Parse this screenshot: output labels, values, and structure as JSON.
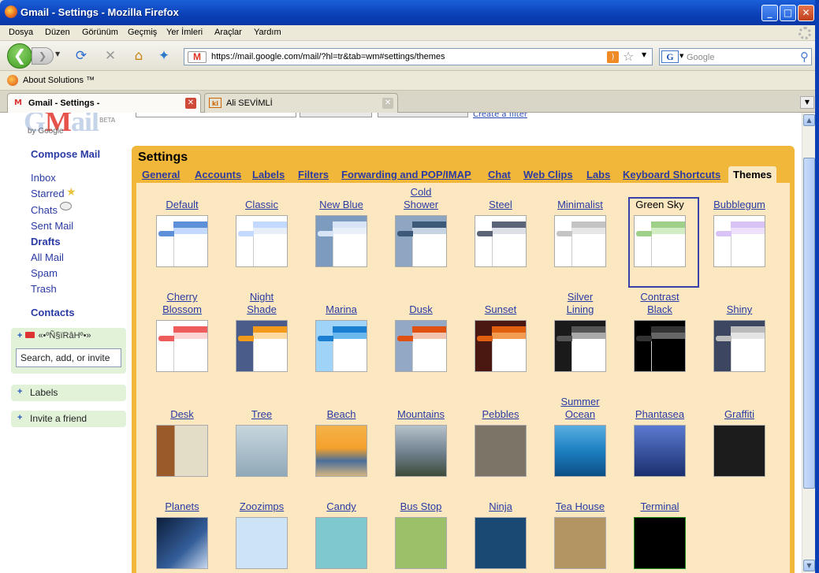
{
  "window": {
    "title": "Gmail - Settings - Mozilla Firefox"
  },
  "menu": [
    "Dosya",
    "Düzen",
    "Görünüm",
    "Geçmiş",
    "Yer İmleri",
    "Araçlar",
    "Yardım"
  ],
  "nav": {
    "url": "https://mail.google.com/mail/?hl=tr&tab=wm#settings/themes",
    "search_placeholder": "Google"
  },
  "bookmarks": {
    "item": "About Solutions ™"
  },
  "tabs": [
    {
      "label": "Gmail - Settings -",
      "active": true
    },
    {
      "label": "Ali SEVİMLİ",
      "active": false
    }
  ],
  "gmail": {
    "logo_by": "by Google",
    "logo_beta": "BETA",
    "create_filter": "Create a filter",
    "compose": "Compose Mail",
    "nav": [
      "Inbox",
      "Starred",
      "Chats",
      "Sent Mail",
      "Drafts",
      "All Mail",
      "Spam",
      "Trash"
    ],
    "contacts": "Contacts",
    "chat_status": "«•ºÑ§ïRâHº•»",
    "chat_search": "Search, add, or invite",
    "labels_box": "Labels",
    "invite_box": "Invite a friend"
  },
  "settings": {
    "title": "Settings",
    "tabs": [
      "General",
      "Accounts",
      "Labels",
      "Filters",
      "Forwarding and POP/IMAP",
      "Chat",
      "Web Clips",
      "Labs",
      "Keyboard Shortcuts",
      "Themes"
    ],
    "selected_tab": "Themes",
    "selected_theme": "Green Sky",
    "themes": [
      {
        "name": "Default",
        "top": "#5e8fd9",
        "sub": "#c3d9ff",
        "bg": "#ffffff"
      },
      {
        "name": "Classic",
        "top": "#c3d9ff",
        "sub": "#e8eef7",
        "bg": "#ffffff"
      },
      {
        "name": "New Blue",
        "top": "#d6e4f5",
        "sub": "#e9eff8",
        "bg": "#7c9bbf"
      },
      {
        "name": "Cold Shower",
        "top": "#3d5a7a",
        "sub": "#c5d3e2",
        "bg": "#8ea6c1"
      },
      {
        "name": "Steel",
        "top": "#5b6577",
        "sub": "#dcdfe6",
        "bg": "#ffffff"
      },
      {
        "name": "Minimalist",
        "top": "#c4c4c4",
        "sub": "#e6e6e6",
        "bg": "#ffffff"
      },
      {
        "name": "Green Sky",
        "top": "#9ed089",
        "sub": "#d2ecc4",
        "bg": "#ffffff"
      },
      {
        "name": "Bubblegum",
        "top": "#d9c2f5",
        "sub": "#ede0fb",
        "bg": "#ffffff"
      },
      {
        "name": "Cherry Blossom",
        "top": "#ee5c5c",
        "sub": "#fcd4d4",
        "bg": "#ffffff"
      },
      {
        "name": "Night Shade",
        "top": "#f39a1a",
        "sub": "#fbd9a0",
        "bg": "#4a5d8a"
      },
      {
        "name": "Marina",
        "top": "#1a7fd0",
        "sub": "#6bb8ef",
        "bg": "#9fd3f7"
      },
      {
        "name": "Dusk",
        "top": "#e05010",
        "sub": "#f4c3ae",
        "bg": "#93a8c4"
      },
      {
        "name": "Sunset",
        "top": "#e06010",
        "sub": "#f49b52",
        "bg": "#4a1810"
      },
      {
        "name": "Silver Lining",
        "top": "#555555",
        "sub": "#aaaaaa",
        "bg": "#1a1a1a"
      },
      {
        "name": "Contrast Black",
        "top": "#333333",
        "sub": "#666666",
        "bg": "#000000"
      },
      {
        "name": "Shiny",
        "top": "#bbbbbb",
        "sub": "#e4e4e4",
        "bg": "#3c4660"
      },
      {
        "name": "Desk",
        "img": "#9b5a2a"
      },
      {
        "name": "Tree",
        "img": "#90a9b8"
      },
      {
        "name": "Beach",
        "img": "#f3a12c"
      },
      {
        "name": "Mountains",
        "img": "#6e7f8c"
      },
      {
        "name": "Pebbles",
        "img": "#7d7468"
      },
      {
        "name": "Summer Ocean",
        "img": "#1c7fc1"
      },
      {
        "name": "Phantasea",
        "img": "#1b2f6e"
      },
      {
        "name": "Graffiti",
        "img": "#1c1c1c"
      },
      {
        "name": "Planets",
        "img": "#345e9a"
      },
      {
        "name": "Zoozimps",
        "img": "#cde3f6"
      },
      {
        "name": "Candy",
        "img": "#7fc8d0"
      },
      {
        "name": "Bus Stop",
        "img": "#9cbf6a"
      },
      {
        "name": "Ninja",
        "img": "#1a4a73"
      },
      {
        "name": "Tea House",
        "img": "#b39564"
      },
      {
        "name": "Terminal",
        "img": "#000000"
      }
    ]
  }
}
